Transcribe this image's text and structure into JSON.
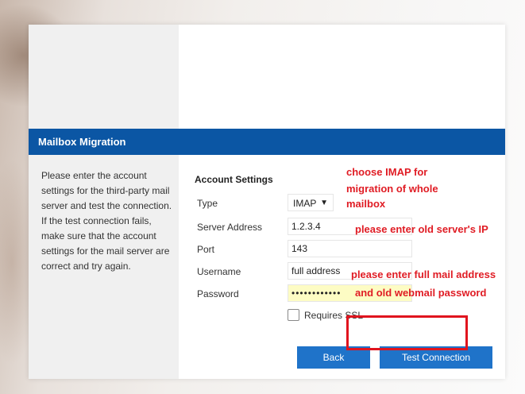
{
  "dialog": {
    "title": "Mailbox Migration",
    "description": "Please enter the account settings for the third-party mail server and test the connection. If the test connection fails, make sure that the account settings for the mail server are correct and try again."
  },
  "form": {
    "section_title": "Account Settings",
    "type": {
      "label": "Type",
      "value": "IMAP",
      "caret": "▼"
    },
    "server": {
      "label": "Server Address",
      "value": "1.2.3.4"
    },
    "port": {
      "label": "Port",
      "value": "143"
    },
    "username": {
      "label": "Username",
      "value": "full address"
    },
    "password": {
      "label": "Password",
      "value": "••••••••••••"
    },
    "ssl": {
      "label": "Requires SSL",
      "checked": false
    }
  },
  "buttons": {
    "back": "Back",
    "test": "Test Connection"
  },
  "annotations": {
    "imap_line1": "choose IMAP for",
    "imap_line2": "migration of whole",
    "imap_line3": "mailbox",
    "server": "please enter old server's IP",
    "creds_line1": "please enter full mail address",
    "creds_line2": "and old webmail password"
  },
  "colors": {
    "title_bar": "#0b56a4",
    "button": "#1f73c9",
    "annotation": "#e01c24",
    "highlight_box": "#e0141e"
  }
}
